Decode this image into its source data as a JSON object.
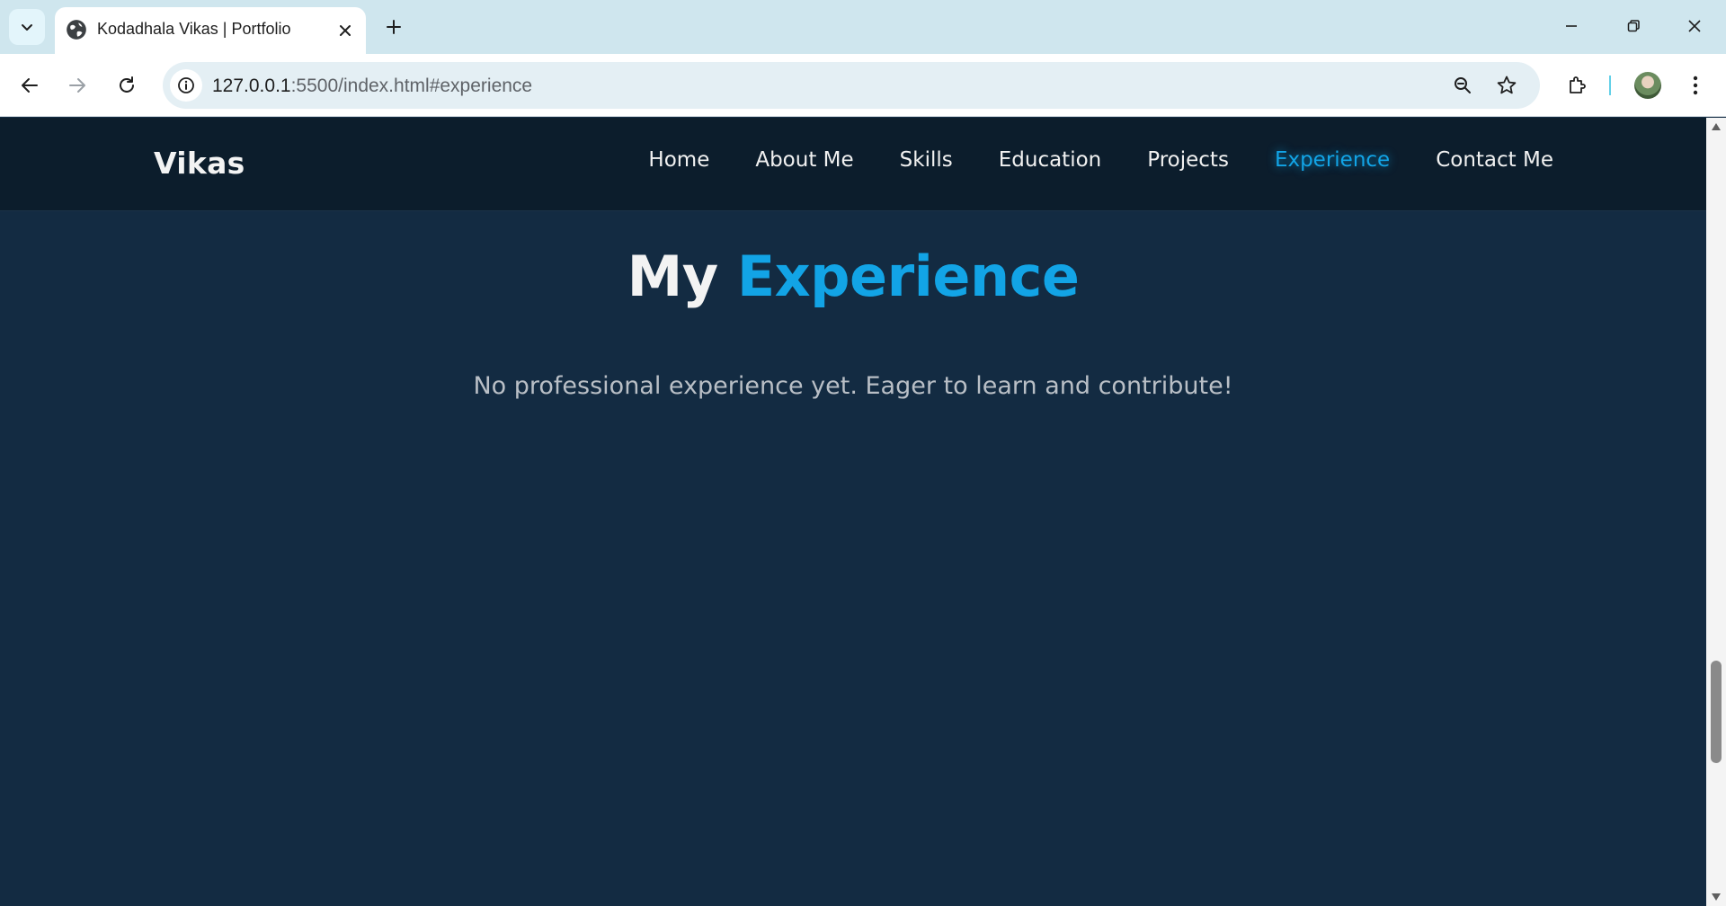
{
  "browser": {
    "tab": {
      "title": "Kodadhala Vikas | Portfolio"
    },
    "address": {
      "host": "127.0.0.1",
      "rest": ":5500/index.html#experience"
    },
    "icons": {
      "tab_list": "chevron-down-icon",
      "favicon": "globe-icon",
      "tab_close": "close-icon",
      "new_tab": "plus-icon",
      "minimize": "minimize-icon",
      "restore": "restore-icon",
      "close_window": "close-icon",
      "back": "back-arrow-icon",
      "forward": "forward-arrow-icon",
      "reload": "reload-icon",
      "site_info": "info-icon",
      "zoom": "zoom-icon",
      "bookmark": "star-icon",
      "extensions": "puzzle-icon",
      "profile": "avatar",
      "menu": "kebab-menu-icon"
    }
  },
  "page": {
    "brand": "Vikas",
    "nav": {
      "items": [
        {
          "label": "Home"
        },
        {
          "label": "About Me"
        },
        {
          "label": "Skills"
        },
        {
          "label": "Education"
        },
        {
          "label": "Projects"
        },
        {
          "label": "Experience",
          "active": true
        },
        {
          "label": "Contact Me"
        }
      ]
    },
    "section": {
      "title_prefix": "My",
      "title_accent": "Experience",
      "text": "No professional experience yet. Eager to learn and contribute!"
    },
    "colors": {
      "accent": "#12a4e6",
      "nav_bg": "#0c1d2c",
      "page_bg": "#132b42",
      "tab_strip_bg": "#cfe6ee"
    }
  }
}
